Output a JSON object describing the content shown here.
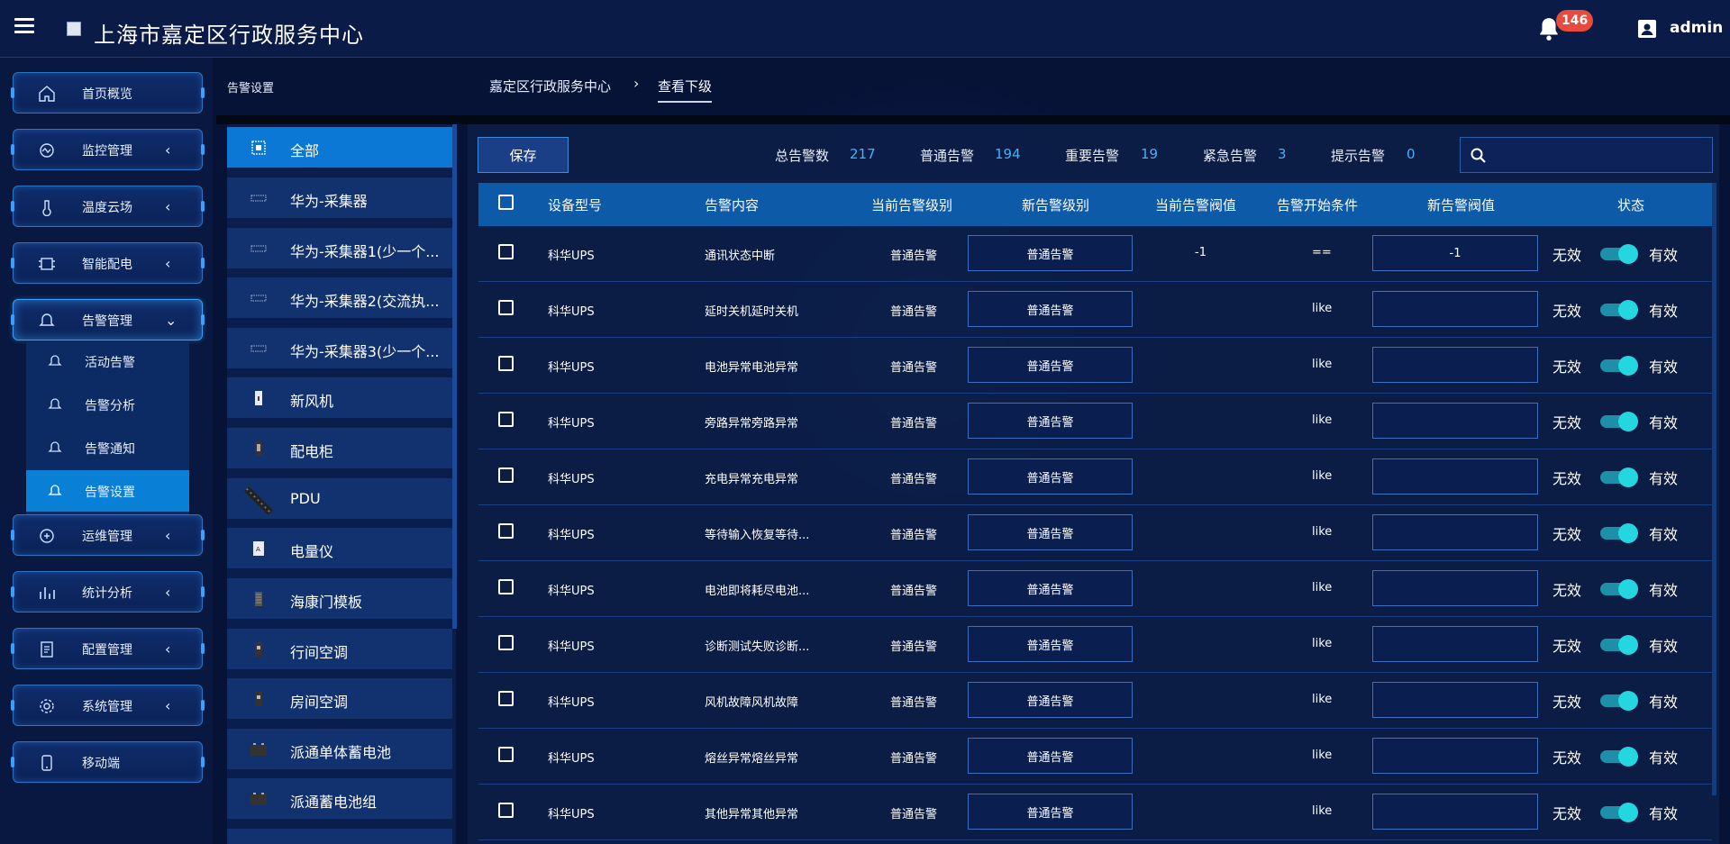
{
  "header": {
    "title": "上海市嘉定区行政服务中心",
    "notification_count": "146",
    "username": "admin"
  },
  "nav": {
    "items": [
      {
        "label": "首页概览",
        "icon": "home-icon"
      },
      {
        "label": "监控管理",
        "icon": "monitor-icon",
        "chevron": "‹"
      },
      {
        "label": "温度云场",
        "icon": "thermometer-icon",
        "chevron": "‹"
      },
      {
        "label": "智能配电",
        "icon": "power-icon",
        "chevron": "‹"
      },
      {
        "label": "告警管理",
        "icon": "alarm-icon",
        "chevron": "⌄"
      },
      {
        "label": "运维管理",
        "icon": "maintenance-icon",
        "chevron": "‹"
      },
      {
        "label": "统计分析",
        "icon": "chart-icon",
        "chevron": "‹"
      },
      {
        "label": "配置管理",
        "icon": "config-icon",
        "chevron": "‹"
      },
      {
        "label": "系统管理",
        "icon": "system-icon",
        "chevron": "‹"
      },
      {
        "label": "移动端",
        "icon": "mobile-icon"
      }
    ],
    "sub_items": [
      {
        "label": "活动告警"
      },
      {
        "label": "告警分析"
      },
      {
        "label": "告警通知"
      },
      {
        "label": "告警设置"
      }
    ]
  },
  "page": {
    "section": "告警设置",
    "breadcrumb": "嘉定区行政服务中心",
    "breadcrumb_sep": "›",
    "breadcrumb_current": "查看下级"
  },
  "devices": [
    {
      "label": "全部"
    },
    {
      "label": "华为-采集器"
    },
    {
      "label": "华为-采集器1(少一个..."
    },
    {
      "label": "华为-采集器2(交流执..."
    },
    {
      "label": "华为-采集器3(少一个..."
    },
    {
      "label": "新风机"
    },
    {
      "label": "配电柜"
    },
    {
      "label": "PDU"
    },
    {
      "label": "电量仪"
    },
    {
      "label": "海康门模板"
    },
    {
      "label": "行间空调"
    },
    {
      "label": "房间空调"
    },
    {
      "label": "派通单体蓄电池"
    },
    {
      "label": "派通蓄电池组"
    }
  ],
  "toolbar": {
    "save_label": "保存",
    "stats": [
      {
        "label": "总告警数",
        "value": "217"
      },
      {
        "label": "普通告警",
        "value": "194"
      },
      {
        "label": "重要告警",
        "value": "19"
      },
      {
        "label": "紧急告警",
        "value": "3"
      },
      {
        "label": "提示告警",
        "value": "0"
      }
    ],
    "search_placeholder": ""
  },
  "table": {
    "columns": [
      "设备型号",
      "告警内容",
      "当前告警级别",
      "新告警级别",
      "当前告警阀值",
      "告警开始条件",
      "新告警阀值",
      "状态"
    ],
    "status_off": "无效",
    "status_on": "有效",
    "rows": [
      {
        "model": "科华UPS",
        "content": "通讯状态中断",
        "level": "普通告警",
        "new_level": "普通告警",
        "threshold": "-1",
        "condition": "==",
        "new_threshold": "-1"
      },
      {
        "model": "科华UPS",
        "content": "延时关机延时关机",
        "level": "普通告警",
        "new_level": "普通告警",
        "threshold": "",
        "condition": "like",
        "new_threshold": ""
      },
      {
        "model": "科华UPS",
        "content": "电池异常电池异常",
        "level": "普通告警",
        "new_level": "普通告警",
        "threshold": "",
        "condition": "like",
        "new_threshold": ""
      },
      {
        "model": "科华UPS",
        "content": "旁路异常旁路异常",
        "level": "普通告警",
        "new_level": "普通告警",
        "threshold": "",
        "condition": "like",
        "new_threshold": ""
      },
      {
        "model": "科华UPS",
        "content": "充电异常充电异常",
        "level": "普通告警",
        "new_level": "普通告警",
        "threshold": "",
        "condition": "like",
        "new_threshold": ""
      },
      {
        "model": "科华UPS",
        "content": "等待输入恢复等待...",
        "level": "普通告警",
        "new_level": "普通告警",
        "threshold": "",
        "condition": "like",
        "new_threshold": ""
      },
      {
        "model": "科华UPS",
        "content": "电池即将耗尽电池...",
        "level": "普通告警",
        "new_level": "普通告警",
        "threshold": "",
        "condition": "like",
        "new_threshold": ""
      },
      {
        "model": "科华UPS",
        "content": "诊断测试失败诊断...",
        "level": "普通告警",
        "new_level": "普通告警",
        "threshold": "",
        "condition": "like",
        "new_threshold": ""
      },
      {
        "model": "科华UPS",
        "content": "风机故障风机故障",
        "level": "普通告警",
        "new_level": "普通告警",
        "threshold": "",
        "condition": "like",
        "new_threshold": ""
      },
      {
        "model": "科华UPS",
        "content": "熔丝异常熔丝异常",
        "level": "普通告警",
        "new_level": "普通告警",
        "threshold": "",
        "condition": "like",
        "new_threshold": ""
      },
      {
        "model": "科华UPS",
        "content": "其他异常其他异常",
        "level": "普通告警",
        "new_level": "普通告警",
        "threshold": "",
        "condition": "like",
        "new_threshold": ""
      }
    ]
  }
}
